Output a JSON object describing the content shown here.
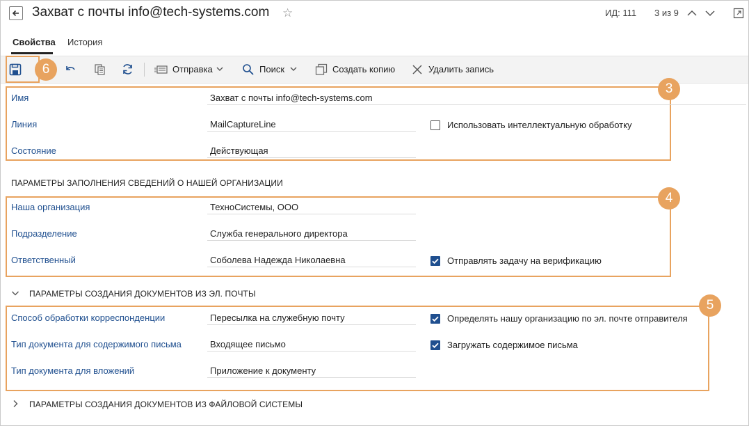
{
  "header": {
    "title": "Захват с почты info@tech-systems.com",
    "id_label": "ИД: 111",
    "pager": "3 из 9"
  },
  "tabs": [
    {
      "label": "Свойства",
      "active": true
    },
    {
      "label": "История",
      "active": false
    }
  ],
  "toolbar": {
    "send_label": "Отправка",
    "search_label": "Поиск",
    "copy_label": "Создать копию",
    "delete_label": "Удалить запись"
  },
  "badges": {
    "b3": "3",
    "b4": "4",
    "b5": "5",
    "b6": "6"
  },
  "main_fields": {
    "name_label": "Имя",
    "name_value": "Захват с почты info@tech-systems.com",
    "line_label": "Линия",
    "line_value": "MailCaptureLine",
    "state_label": "Состояние",
    "state_value": "Действующая",
    "intelligent_label": "Использовать интеллектуальную обработку",
    "intelligent_checked": false
  },
  "org_section": {
    "title": "ПАРАМЕТРЫ ЗАПОЛНЕНИЯ СВЕДЕНИЙ О НАШЕЙ ОРГАНИЗАЦИИ",
    "org_label": "Наша организация",
    "org_value": "ТехноСистемы, ООО",
    "dept_label": "Подразделение",
    "dept_value": "Служба генерального директора",
    "resp_label": "Ответственный",
    "resp_value": "Соболева Надежда Николаевна",
    "verify_label": "Отправлять задачу на верификацию",
    "verify_checked": true
  },
  "mail_section": {
    "title": "ПАРАМЕТРЫ СОЗДАНИЯ ДОКУМЕНТОВ ИЗ ЭЛ. ПОЧТЫ",
    "method_label": "Способ обработки корреспонденции",
    "method_value": "Пересылка на служебную почту",
    "content_label": "Тип документа для содержимого письма",
    "content_value": "Входящее письмо",
    "attach_label": "Тип документа для вложений",
    "attach_value": "Приложение к документу",
    "detect_org_label": "Определять нашу организацию по эл. почте отправителя",
    "detect_org_checked": true,
    "load_content_label": "Загружать содержимое письма",
    "load_content_checked": true
  },
  "fs_section": {
    "title": "ПАРАМЕТРЫ СОЗДАНИЯ ДОКУМЕНТОВ ИЗ ФАЙЛОВОЙ СИСТЕМЫ"
  },
  "colors": {
    "accent_orange": "#e8a35f",
    "label_blue": "#1f4f8f"
  }
}
